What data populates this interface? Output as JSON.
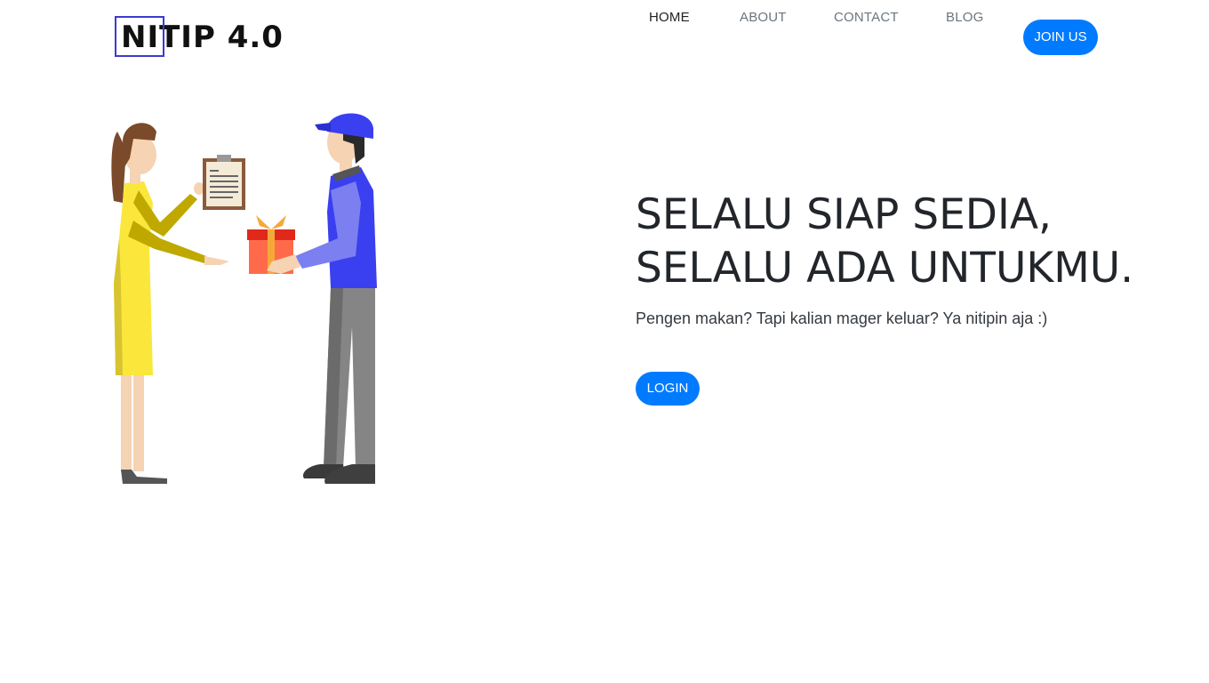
{
  "brand": {
    "name": "NITIP 4.0"
  },
  "nav": {
    "home": "HOME",
    "about": "ABOUT",
    "contact": "CONTACT",
    "blog": "BLOG",
    "join": "JOIN US"
  },
  "hero": {
    "headline_line1": "SELALU SIAP SEDIA,",
    "headline_line2": "SELALU ADA UNTUKMU.",
    "subtitle": "Pengen makan? Tapi kalian mager keluar? Ya nitipin aja :)",
    "login": "LOGIN"
  },
  "colors": {
    "primary": "#007bff",
    "text_dark": "#212529",
    "nav_muted": "#6c757d",
    "logo_box": "#3b3bd1"
  },
  "icons": {
    "illustration": "delivery-handover-illustration"
  }
}
